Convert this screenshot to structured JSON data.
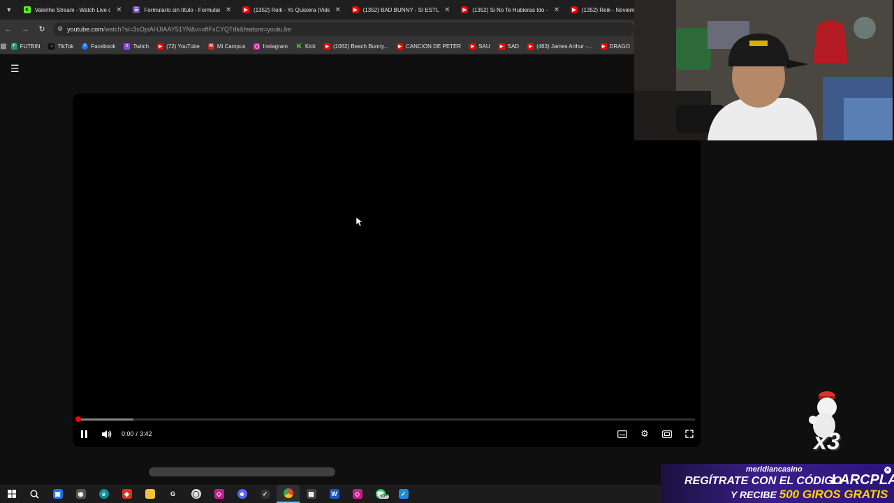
{
  "tabs": [
    {
      "title": "Valerihe Stream - Watch Live on",
      "favicon": "kick-icon",
      "active": false
    },
    {
      "title": "Formulario sin título - Formular",
      "favicon": "forms-icon",
      "active": false
    },
    {
      "title": "(1352) Reik - Yo Quisiera (Vide",
      "favicon": "youtube-icon",
      "active": false
    },
    {
      "title": "(1352) BAD BUNNY - SI ESTUVI",
      "favicon": "youtube-icon",
      "active": false
    },
    {
      "title": "(1352) Si No Te Hubieras Ido - ",
      "favicon": "youtube-icon",
      "active": false
    },
    {
      "title": "(1352) Reik - Noviem",
      "favicon": "youtube-icon",
      "active": false
    }
  ],
  "address": {
    "host": "youtube.com",
    "path": "/watch?si=3cOpiAHJIAAY51YN&v=xftFxCYQTdk&feature=youtu.be"
  },
  "bookmarks": [
    {
      "label": "FUTBIN",
      "icon": "futbin-icon"
    },
    {
      "label": "TikTok",
      "icon": "tiktok-icon"
    },
    {
      "label": "Facebook",
      "icon": "facebook-icon"
    },
    {
      "label": "Twitch",
      "icon": "twitch-icon"
    },
    {
      "label": "(72) YouTube",
      "icon": "youtube-icon"
    },
    {
      "label": "Mi Campus",
      "icon": "campus-icon"
    },
    {
      "label": "Instagram",
      "icon": "instagram-icon"
    },
    {
      "label": "Kick",
      "icon": "kick-icon"
    },
    {
      "label": "(1062) Beach Bunny...",
      "icon": "youtube-icon"
    },
    {
      "label": "CANCION DE PETER",
      "icon": "youtube-icon"
    },
    {
      "label": "SAU",
      "icon": "youtube-icon"
    },
    {
      "label": "SAD",
      "icon": "youtube-icon"
    },
    {
      "label": "(463) James Arthur -...",
      "icon": "youtube-icon"
    },
    {
      "label": "DRAGO",
      "icon": "youtube-icon"
    }
  ],
  "player": {
    "current_time": "0:00",
    "duration": "3:42",
    "time_separator": "/",
    "played_fraction": 0.0,
    "buffered_fraction": 0.09,
    "state": "playing"
  },
  "overlay": {
    "multiplier": "x3"
  },
  "banner": {
    "brand": "meridiancasino",
    "line1": "REGÍTRATE CON EL CÓDIGO",
    "code": "LARCPLAY",
    "line2_prefix": "Y RECIBE",
    "line2_highlight": "500 GIROS GRATIS"
  },
  "taskbar": {
    "whatsapp_badge": "99+"
  },
  "colors": {
    "youtube_red": "#ff0000",
    "kick_green": "#53fc18",
    "banner_purple": "#3a1f8a",
    "highlight_yellow": "#ffd400"
  }
}
